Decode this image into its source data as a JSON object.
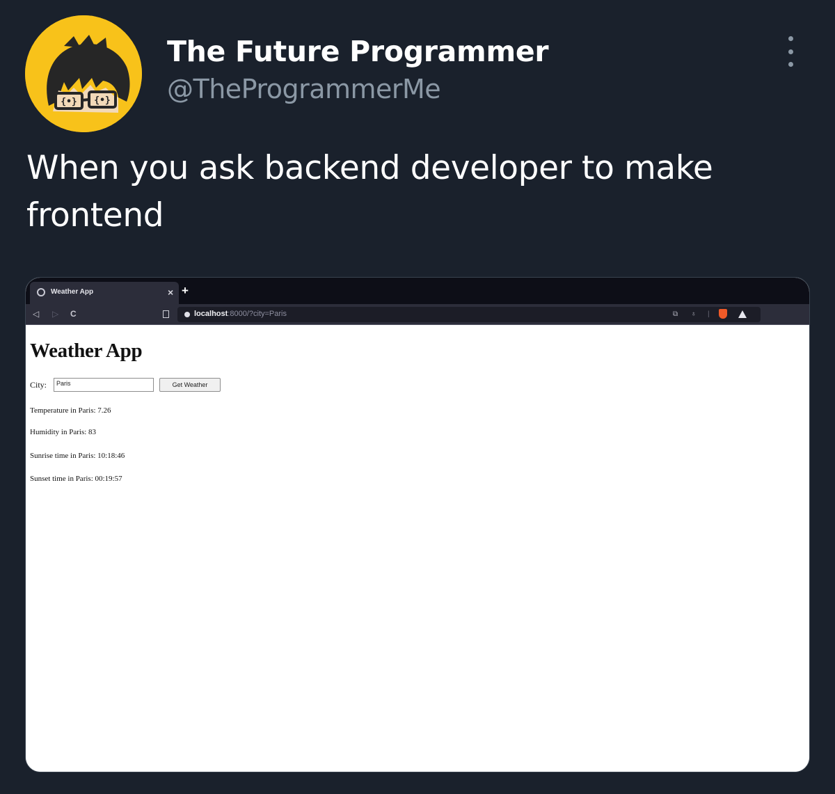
{
  "tweet": {
    "display_name": "The Future Programmer",
    "handle": "@TheProgrammerMe",
    "text": "When you ask backend developer to make frontend",
    "avatar_glasses_text": "{•}{•}",
    "more_icon": "more-icon"
  },
  "screenshot": {
    "browser": {
      "tab_title": "Weather App",
      "tab_close": "×",
      "new_tab": "+",
      "nav_back": "◁",
      "nav_forward": "▷",
      "nav_reload": "C",
      "url_host": "localhost",
      "url_rest": ":8000/?city=Paris"
    },
    "app": {
      "title": "Weather App",
      "city_label": "City:",
      "city_value": "Paris",
      "button_label": "Get Weather",
      "results": [
        "Temperature in Paris: 7.26",
        "Humidity in Paris: 83",
        "Sunrise time in Paris: 10:18:46",
        "Sunset time in Paris: 00:19:57"
      ]
    }
  },
  "colors": {
    "background": "#1a212c",
    "avatar": "#f8c21a",
    "handle": "#8b98a5",
    "text": "#ffffff"
  }
}
